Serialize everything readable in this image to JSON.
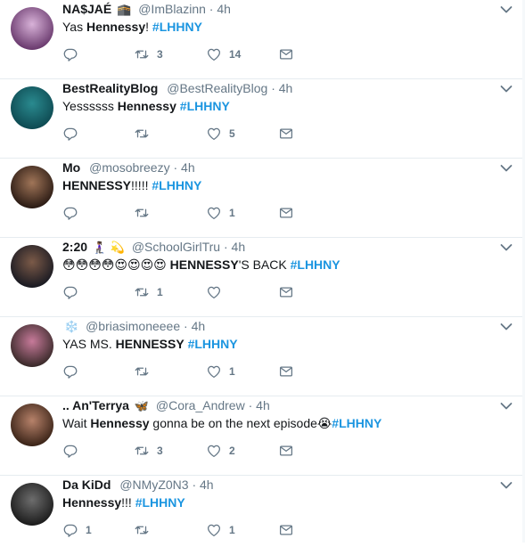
{
  "tweets": [
    {
      "name": "NA$JAÉ",
      "badge": "🕋",
      "handle": "@ImBlazinn",
      "time": "4h",
      "text_parts": [
        "Yas ",
        "Hennessy",
        "! "
      ],
      "hashtag": "#LHHNY",
      "retweets": "3",
      "likes": "14",
      "replies": "",
      "avatar_colors": [
        "#6a3a6e",
        "#d8b2d8"
      ]
    },
    {
      "name": "BestRealityBlog",
      "badge": "",
      "handle": "@BestRealityBlog",
      "time": "4h",
      "text_parts": [
        "Yessssss ",
        "Hennessy",
        " "
      ],
      "hashtag": "#LHHNY",
      "retweets": "",
      "likes": "5",
      "replies": "",
      "avatar_colors": [
        "#0e4a52",
        "#2a8a8f"
      ]
    },
    {
      "name": "Mo",
      "badge": "",
      "handle": "@mosobreezy",
      "time": "4h",
      "text_parts": [
        "",
        "HENNESSY",
        "!!!!! "
      ],
      "hashtag": "#LHHNY",
      "retweets": "",
      "likes": "1",
      "replies": "",
      "avatar_colors": [
        "#2b1b14",
        "#a07558"
      ]
    },
    {
      "name": "2:20",
      "badge": "🧎🏾‍♀️ 💫",
      "handle": "@SchoolGirlTru",
      "time": "4h",
      "emoji_prefix": "😳😳😳😳😍😍😍😍",
      "text_parts": [
        " ",
        "HENNESSY",
        "'S BACK "
      ],
      "hashtag": "#LHHNY",
      "retweets": "1",
      "likes": "",
      "replies": "",
      "avatar_colors": [
        "#1a1a22",
        "#7b5a48"
      ]
    },
    {
      "name": "",
      "badge": "❄️",
      "handle": "@briasimoneeee",
      "time": "4h",
      "text_parts": [
        "YAS MS. ",
        "HENNESSY",
        " "
      ],
      "hashtag": "#LHHNY",
      "retweets": "",
      "likes": "1",
      "replies": "",
      "avatar_colors": [
        "#3a2a2a",
        "#c77a9a"
      ]
    },
    {
      "name": ".. An'Terrya",
      "badge": "🦋",
      "handle": "@Cora_Andrew",
      "time": "4h",
      "text_parts": [
        "Wait ",
        "Hennessy",
        " gonna be on the next episode"
      ],
      "emoji_suffix": "😭",
      "hashtag": "#LHHNY",
      "retweets": "3",
      "likes": "2",
      "replies": "",
      "avatar_colors": [
        "#3b2418",
        "#b7826a"
      ]
    },
    {
      "name": "Da KiDd",
      "badge": "",
      "handle": "@NMyZ0N3",
      "time": "4h",
      "text_parts": [
        "",
        "Hennessy",
        "!!! "
      ],
      "hashtag": "#LHHNY",
      "retweets": "",
      "likes": "1",
      "replies": "1",
      "avatar_colors": [
        "#1c1c1c",
        "#6d6d6d"
      ]
    }
  ],
  "separator": "·",
  "colors": {
    "hashtag": "#1b95e0",
    "meta": "#657786",
    "divider": "#e6ecf0"
  },
  "icons": [
    "reply-icon",
    "retweet-icon",
    "like-icon",
    "direct-message-icon",
    "chevron-down-icon"
  ]
}
